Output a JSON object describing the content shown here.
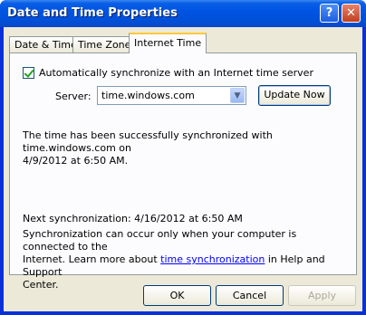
{
  "window": {
    "title": "Date and Time Properties"
  },
  "titlebar_buttons": {
    "help": "?",
    "close": "✕"
  },
  "tabs": [
    {
      "label": "Date & Time"
    },
    {
      "label": "Time Zone"
    },
    {
      "label": "Internet Time"
    }
  ],
  "internet_time": {
    "auto_sync_label": "Automatically synchronize with an Internet time server",
    "auto_sync_checked": true,
    "server_label": "Server:",
    "server_value": "time.windows.com",
    "update_button": "Update Now",
    "status_line1": "The time has been successfully synchronized with time.windows.com on",
    "status_line2": "4/9/2012 at 6:50 AM.",
    "next_sync": "Next synchronization: 4/16/2012 at 6:50 AM",
    "note_line1": "Synchronization can occur only when your computer is connected to the",
    "note_line2_pre": "Internet.  Learn more about ",
    "note_link": "time synchronization",
    "note_line2_post": " in Help and Support",
    "note_line3": "Center."
  },
  "footer": {
    "ok": "OK",
    "cancel": "Cancel",
    "apply": "Apply"
  }
}
